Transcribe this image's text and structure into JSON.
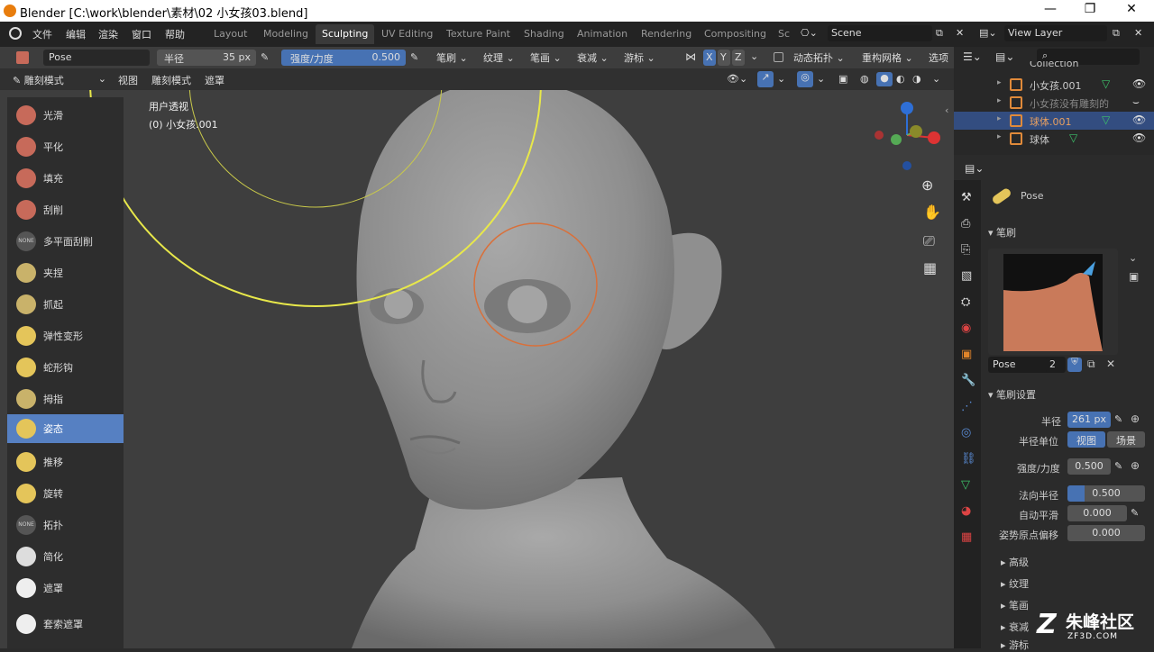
{
  "titlebar": {
    "title": "Blender [C:\\work\\blender\\素材\\02 小女孩03.blend]",
    "min": "—",
    "max": "❐",
    "close": "✕"
  },
  "menubar": {
    "menus": [
      "文件",
      "编辑",
      "渲染",
      "窗口",
      "帮助"
    ],
    "workspaces": [
      "Layout",
      "Modeling",
      "Sculpting",
      "UV Editing",
      "Texture Paint",
      "Shading",
      "Animation",
      "Rendering",
      "Compositing",
      "Sc"
    ],
    "active_workspace": "Sculpting",
    "scene": "Scene",
    "view_layer": "View Layer"
  },
  "toolheader": {
    "brush_name": "Pose",
    "radius_label": "半径",
    "radius_value": "35 px",
    "strength_label": "强度/力度",
    "strength_value": "0.500",
    "menus": [
      "笔刷",
      "纹理",
      "笔画",
      "衰减",
      "游标"
    ],
    "axes": [
      "X",
      "Y",
      "Z"
    ],
    "dyntopo": "动态拓扑",
    "remesh": "重构网格",
    "options": "选项"
  },
  "modeheader": {
    "mode": "雕刻模式",
    "menus": [
      "视图",
      "雕刻模式",
      "遮罩"
    ]
  },
  "viewport": {
    "view_name": "用户透视",
    "object_name": "(0) 小女孩.001"
  },
  "tools": [
    {
      "label": "光滑",
      "color": "#c76a5a"
    },
    {
      "label": "平化",
      "color": "#c76a5a"
    },
    {
      "label": "填充",
      "color": "#c76a5a"
    },
    {
      "label": "刮削",
      "color": "#c76a5a"
    },
    {
      "label": "多平面刮削",
      "color": "#555555",
      "badge": "NONE"
    },
    {
      "label": "夹捏",
      "color": "#c9b26a"
    },
    {
      "label": "抓起",
      "color": "#c9b26a"
    },
    {
      "label": "弹性变形",
      "color": "#e4c55a"
    },
    {
      "label": "蛇形钩",
      "color": "#e4c55a"
    },
    {
      "label": "拇指",
      "color": "#c9b26a"
    },
    {
      "label": "姿态",
      "color": "#e4c55a"
    },
    {
      "label": "推移",
      "color": "#e4c55a"
    },
    {
      "label": "旋转",
      "color": "#e4c55a"
    },
    {
      "label": "拓扑",
      "color": "#555555",
      "badge": "NONE"
    },
    {
      "label": "简化",
      "color": "#dddddd"
    },
    {
      "label": "遮罩",
      "color": "#eeeeee"
    },
    {
      "label": "套索遮罩",
      "color": "#eeeeee"
    }
  ],
  "active_tool": "姿态",
  "outliner": {
    "items": [
      {
        "label": "Collection"
      },
      {
        "label": "小女孩.001"
      },
      {
        "label": "小女孩没有雕刻的"
      },
      {
        "label": "球体.001"
      },
      {
        "label": "球体"
      }
    ],
    "selected": "球体.001"
  },
  "props": {
    "brush_name": "Pose",
    "section_brush": "笔刷",
    "brush_slot_name": "Pose",
    "brush_users": "2",
    "section_settings": "笔刷设置",
    "radius_label": "半径",
    "radius_value": "261 px",
    "radius_unit_label": "半径单位",
    "unit_view": "视图",
    "unit_scene": "场景",
    "strength_label": "强度/力度",
    "strength_value": "0.500",
    "normal_radius_label": "法向半径",
    "normal_radius_value": "0.500",
    "autosmooth_label": "自动平滑",
    "autosmooth_value": "0.000",
    "pose_offset_label": "姿势原点偏移",
    "pose_offset_value": "0.000",
    "sections": [
      "高级",
      "纹理",
      "笔画",
      "衰减",
      "游标"
    ]
  },
  "watermark": {
    "brand": "朱峰社区",
    "site": "ZF3D.COM"
  },
  "colors": {
    "accent": "#5680c2",
    "brush_circle": "#e8e84a",
    "cursor": "#d9703a"
  }
}
